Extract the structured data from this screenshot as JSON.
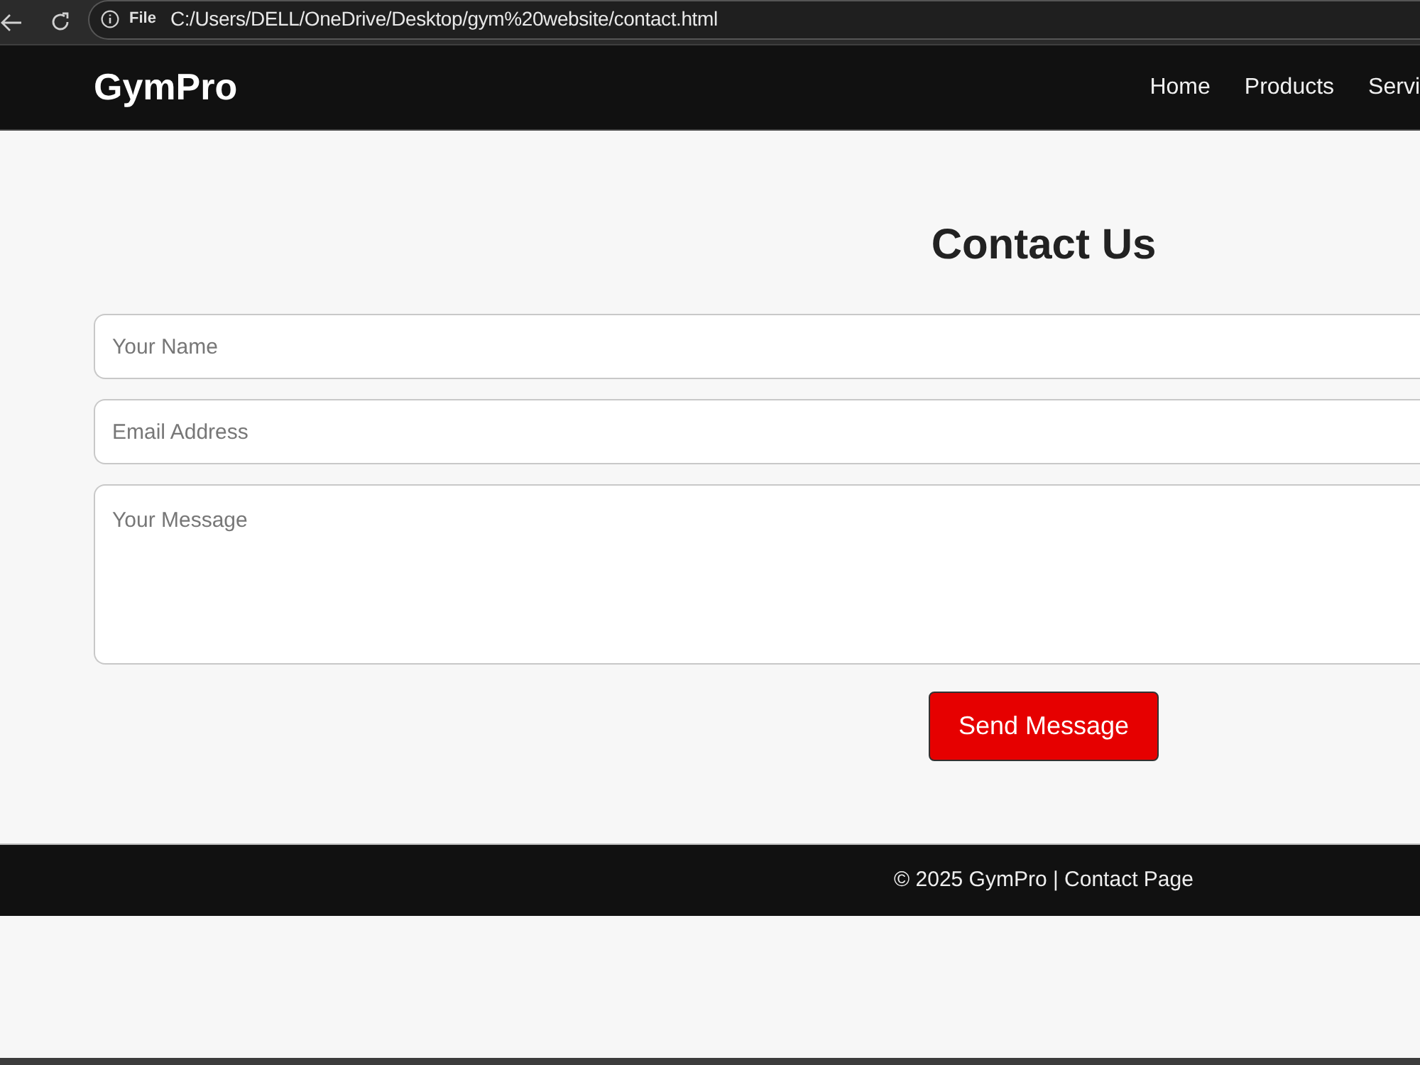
{
  "browser": {
    "address_label": "File",
    "url": "C:/Users/DELL/OneDrive/Desktop/gym%20website/contact.html"
  },
  "navbar": {
    "logo": "GymPro",
    "links": [
      {
        "label": "Home"
      },
      {
        "label": "Products"
      },
      {
        "label": "Servi"
      }
    ]
  },
  "contact": {
    "heading": "Contact Us",
    "fields": [
      {
        "kind": "input",
        "placeholder": "Your Name"
      },
      {
        "kind": "input",
        "placeholder": "Email Address"
      },
      {
        "kind": "textarea",
        "placeholder": "Your Message"
      }
    ],
    "submit": "Send Message"
  },
  "footer": {
    "text": "© 2025 GymPro | Contact Page"
  }
}
